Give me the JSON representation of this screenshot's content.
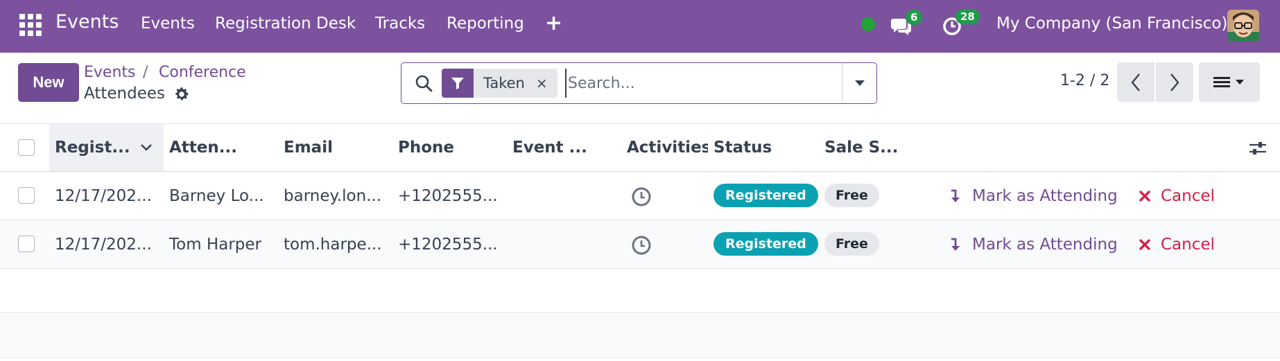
{
  "navbar": {
    "brand": "Events",
    "menu": [
      "Events",
      "Registration Desk",
      "Tracks",
      "Reporting"
    ],
    "messages_count": "6",
    "activities_count": "28",
    "company": "My Company (San Francisco)"
  },
  "control": {
    "new_label": "New",
    "breadcrumb": [
      "Events",
      "Conference"
    ],
    "breadcrumb_sep": "/",
    "title": "Attendees",
    "pager": "1-2 / 2"
  },
  "search": {
    "facet_value": "Taken",
    "facet_remove": "×",
    "placeholder": "Search..."
  },
  "table": {
    "columns": [
      "Regist...",
      "Atten...",
      "Email",
      "Phone",
      "Event ...",
      "Activities",
      "Status",
      "Sale S..."
    ],
    "rows": [
      {
        "registration_date": "12/17/202...",
        "attendee": "Barney Lo...",
        "email": "barney.lon...",
        "phone": "+1202555...",
        "event": "",
        "status": "Registered",
        "sale_status": "Free",
        "attend_label": "Mark as Attending",
        "cancel_label": "Cancel"
      },
      {
        "registration_date": "12/17/202...",
        "attendee": "Tom Harper",
        "email": "tom.harpe...",
        "phone": "+1202555...",
        "event": "",
        "status": "Registered",
        "sale_status": "Free",
        "attend_label": "Mark as Attending",
        "cancel_label": "Cancel"
      }
    ]
  },
  "colors": {
    "navbar": "#7C529E",
    "primary": "#714B93",
    "registered": "#0aa2b3",
    "danger": "#d61e48",
    "online": "#21a338",
    "badge": "#1f9b4b"
  },
  "icons": [
    "apps-grid-icon",
    "plus-icon",
    "chat-icon",
    "clock-icon",
    "gear-icon",
    "search-icon",
    "filter-icon",
    "caret-down-icon",
    "chevron-left-icon",
    "chevron-right-icon",
    "list-view-icon",
    "sort-chevron-icon",
    "column-settings-icon",
    "activity-clock-icon",
    "arrow-down-icon",
    "cross-icon"
  ]
}
